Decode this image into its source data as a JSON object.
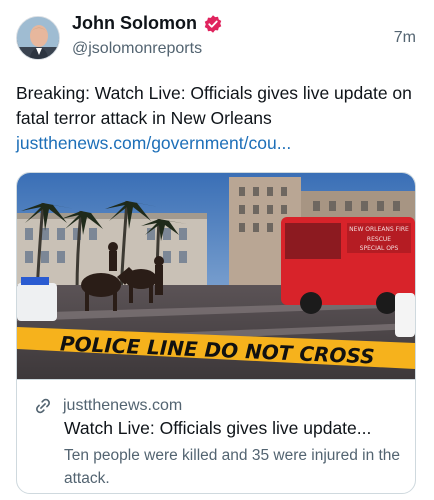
{
  "author": {
    "display_name": "John Solomon",
    "handle": "@jsolomonreports",
    "verified_color": "#e0245e",
    "avatar_icon": "profile-photo"
  },
  "post": {
    "time": "7m",
    "text": "Breaking: Watch Live: Officials gives live update on fatal terror attack in New Orleans",
    "link": "justthenews.com/government/cou..."
  },
  "card": {
    "image_caption_tape": "POLICE LINE DO NOT CROSS",
    "truck_text": "NEW ORLEANS FIRE RESCUE SPECIAL OPS",
    "domain": "justthenews.com",
    "title": "Watch Live: Officials gives live update...",
    "description": "Ten people were killed and 35 were injured in the attack."
  },
  "colors": {
    "link": "#1d6fb8",
    "secondary_text": "#536471",
    "tape_yellow": "#f6b21c",
    "truck_red": "#d8232a"
  }
}
